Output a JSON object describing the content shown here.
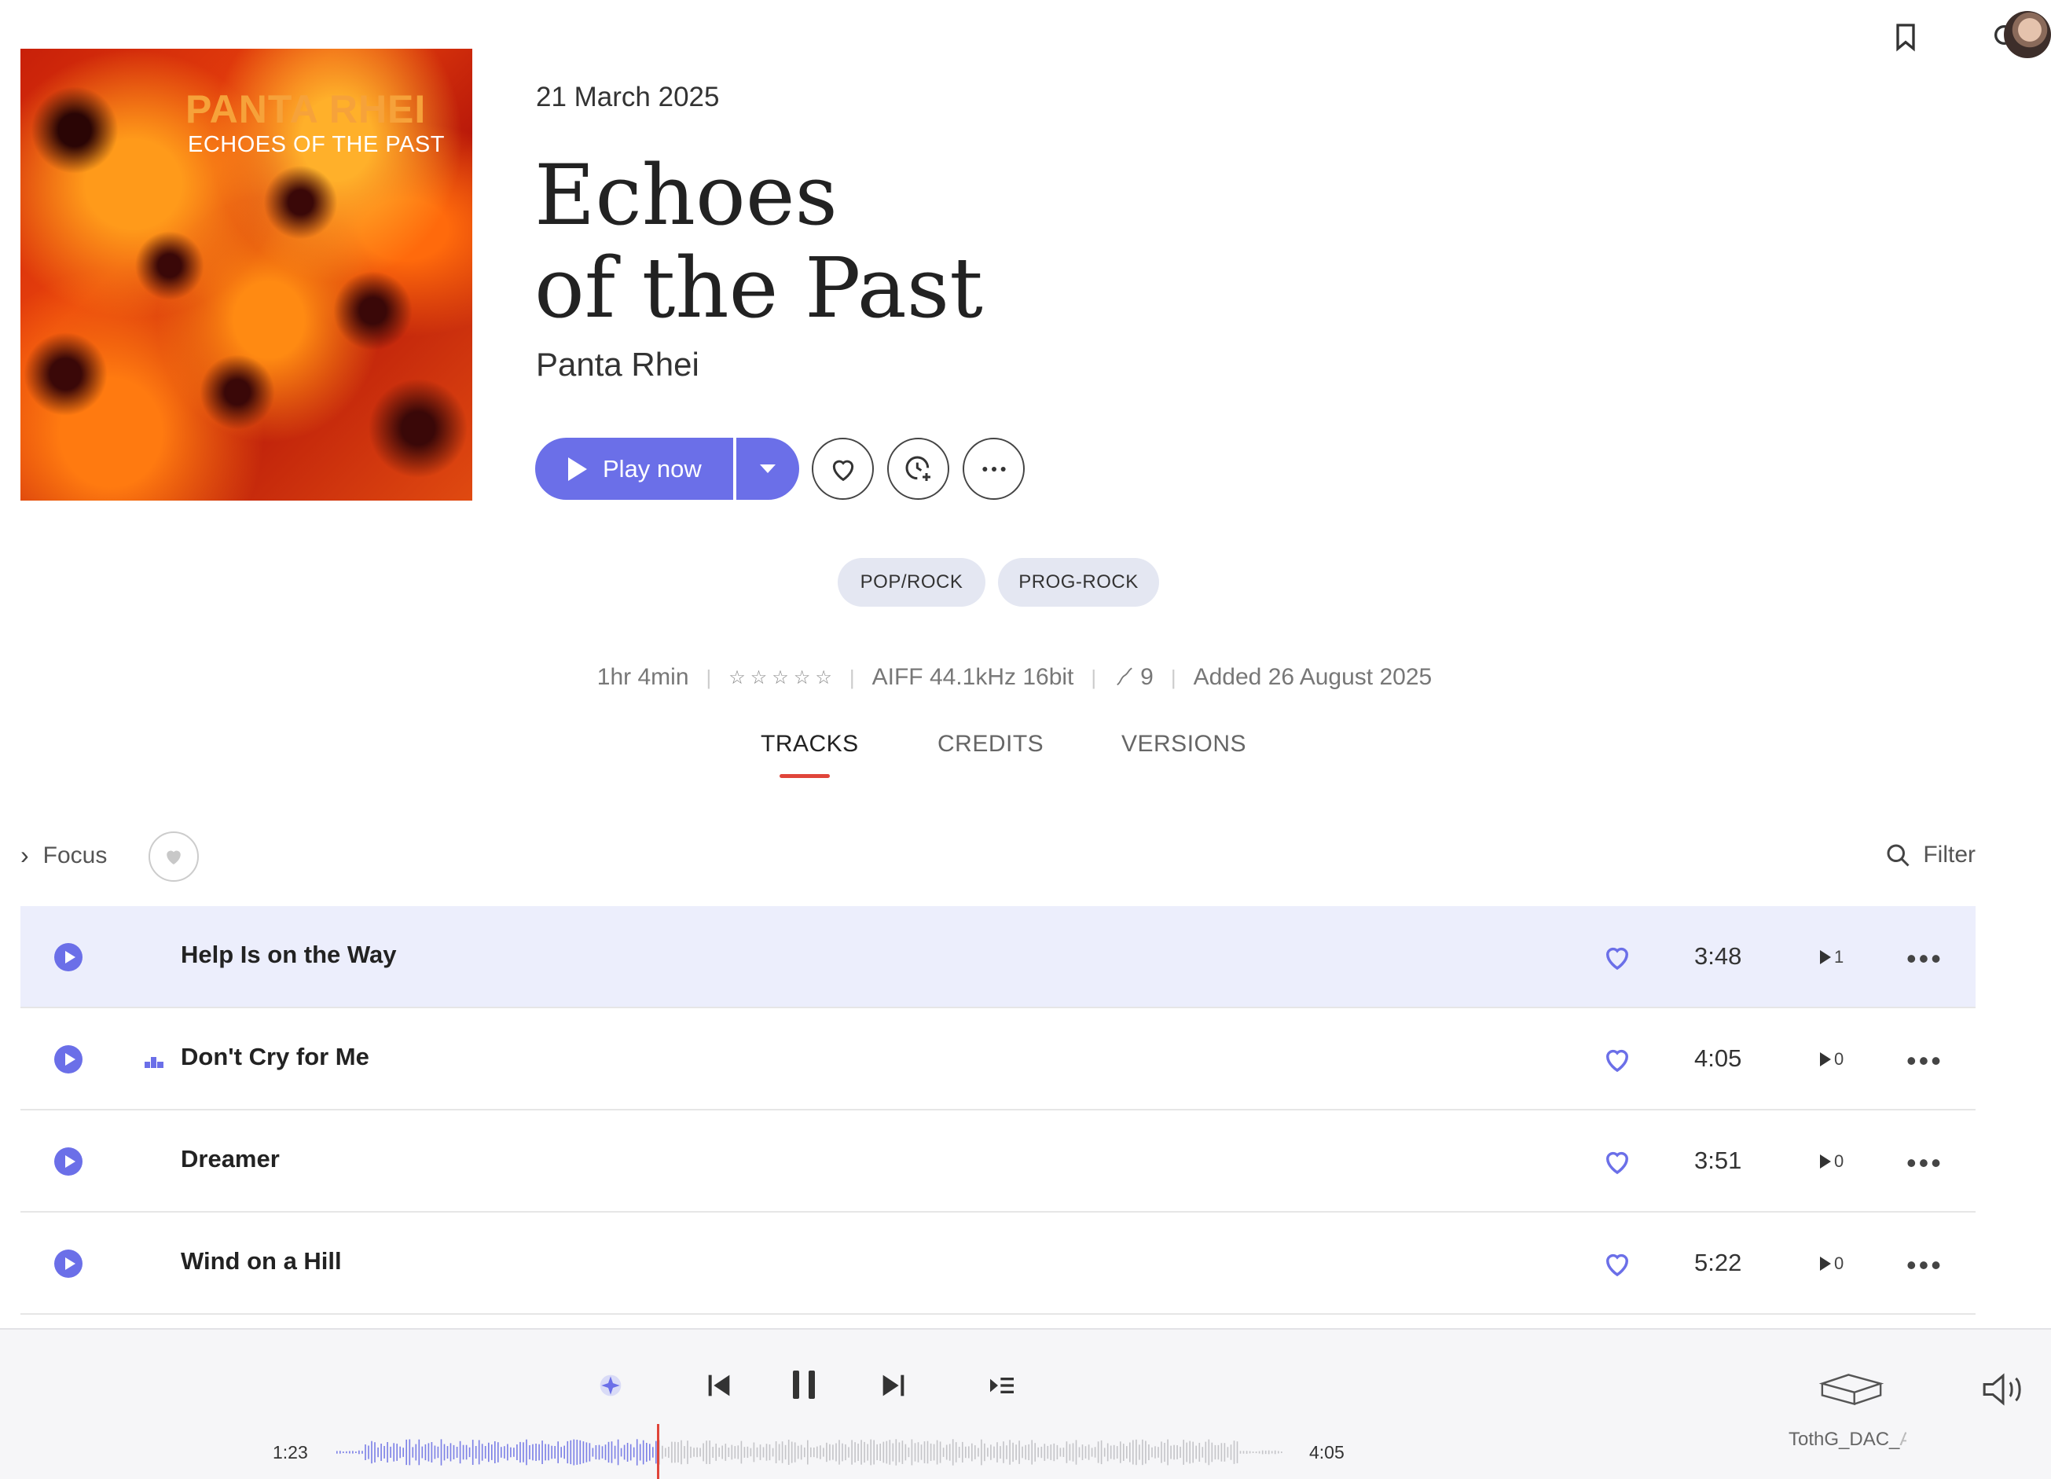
{
  "album": {
    "cover_title": "PANTA RHEI",
    "cover_subtitle": "ECHOES OF THE PAST",
    "release_date": "21 March 2025",
    "title_line1": "Echoes",
    "title_line2": "of the Past",
    "artist": "Panta Rhei"
  },
  "actions": {
    "play_label": "Play now"
  },
  "tags": [
    "POP/ROCK",
    "PROG-ROCK"
  ],
  "meta": {
    "duration": "1hr 4min",
    "rating": 0,
    "stars": [
      "☆",
      "☆",
      "☆",
      "☆",
      "☆"
    ],
    "format": "AIFF 44.1kHz 16bit",
    "track_count": "9",
    "added": "Added 26 August 2025"
  },
  "tabs": [
    "TRACKS",
    "CREDITS",
    "VERSIONS"
  ],
  "tracklist": {
    "focus_label": "Focus",
    "filter_label": "Filter",
    "tracks": [
      {
        "name": "Help Is on the Way",
        "duration": "3:48",
        "plays": "1"
      },
      {
        "name": "Don't Cry for Me",
        "duration": "4:05",
        "plays": "0"
      },
      {
        "name": "Dreamer",
        "duration": "3:51",
        "plays": "0"
      },
      {
        "name": "Wind on a Hill",
        "duration": "5:22",
        "plays": "0"
      }
    ]
  },
  "player": {
    "elapsed": "1:23",
    "total": "4:05",
    "progress": 0.339,
    "device_name": "TothG_DAC_A",
    "device_name_visible": "TothG_DAC_",
    "device_name_faded": "A"
  },
  "colors": {
    "accent": "#6b6fe8",
    "tab_underline": "#e0453a",
    "active_row": "#eceefc"
  },
  "icons": {
    "bookmark": "bookmark-icon",
    "search": "search-icon",
    "heart": "heart-icon",
    "add_to_queue": "clock-plus-icon",
    "more": "more-dots-icon",
    "shuffle": "sparkle-icon",
    "prev": "skip-previous-icon",
    "pause": "pause-icon",
    "next": "skip-next-icon",
    "queue": "queue-icon",
    "device": "dac-device-icon",
    "volume": "volume-icon"
  }
}
